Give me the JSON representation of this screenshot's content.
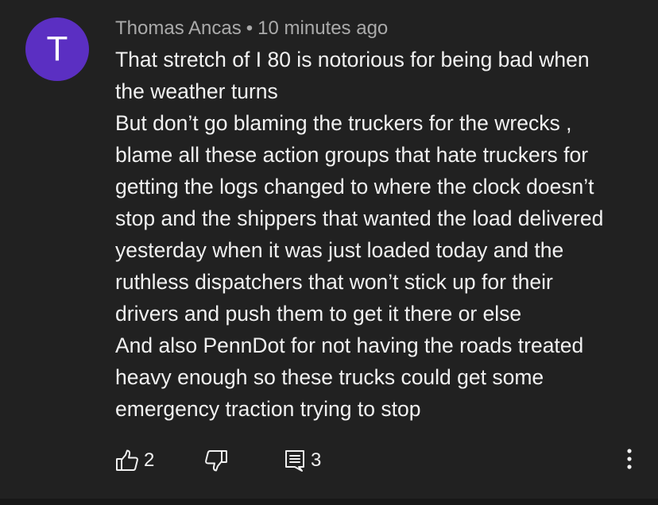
{
  "comment": {
    "avatar_letter": "T",
    "avatar_color": "#5b2fc2",
    "author": "Thomas Ancas",
    "separator": "•",
    "timestamp": "10 minutes ago",
    "lines": [
      "That stretch of I 80 is notorious for being bad when",
      "the weather turns",
      "But don’t go blaming the truckers for the wrecks ,",
      "blame all these action groups that hate truckers for",
      "getting the logs changed to where the clock doesn’t",
      "stop and the shippers that wanted the load delivered",
      "yesterday when it was just loaded today and the",
      "ruthless dispatchers that won’t stick up for their",
      "drivers and push them to get it there or else",
      "And also PennDot for not having the roads treated",
      "heavy enough so these trucks could get some",
      "emergency traction trying to stop"
    ],
    "actions": {
      "like_icon": "thumbs-up-icon",
      "like_count": "2",
      "dislike_icon": "thumbs-down-icon",
      "reply_icon": "comment-icon",
      "reply_count": "3",
      "more_icon": "more-vertical-icon"
    }
  },
  "colors": {
    "background": "#212121",
    "text": "#f1f1f1",
    "secondary_text": "#aaaaaa"
  }
}
